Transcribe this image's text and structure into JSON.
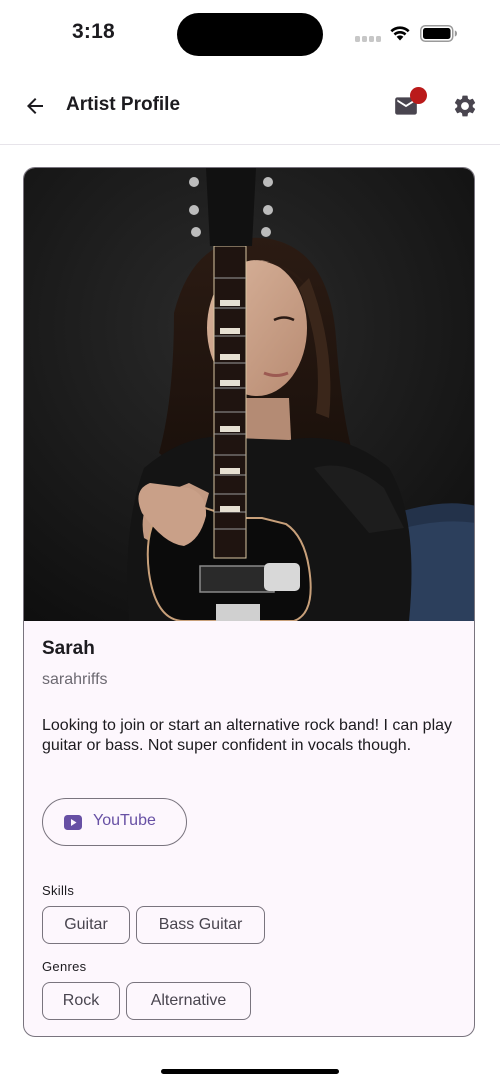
{
  "status_bar": {
    "time": "3:18",
    "icons": [
      "signal-icon",
      "wifi-icon",
      "battery-icon"
    ]
  },
  "app_bar": {
    "title": "Artist Profile",
    "back_icon": "arrow-back-icon",
    "mail_icon": "mail-icon",
    "settings_icon": "gear-icon",
    "has_notification": true
  },
  "profile": {
    "name": "Sarah",
    "handle": "sarahriffs",
    "bio": "Looking to join or start an alternative rock band! I can play guitar or bass. Not super confident in vocals though.",
    "photo_label": "Photo of artist holding an electric guitar",
    "links": [
      {
        "label": "YouTube",
        "icon": "youtube-icon"
      }
    ],
    "skills_label": "Skills",
    "skills": [
      "Guitar",
      "Bass Guitar"
    ],
    "genres_label": "Genres",
    "genres": [
      "Rock",
      "Alternative"
    ]
  },
  "colors": {
    "accent": "#6750a4",
    "notification": "#ba1a1a",
    "card_background": "#fdf7fd",
    "outline": "#79747e"
  }
}
